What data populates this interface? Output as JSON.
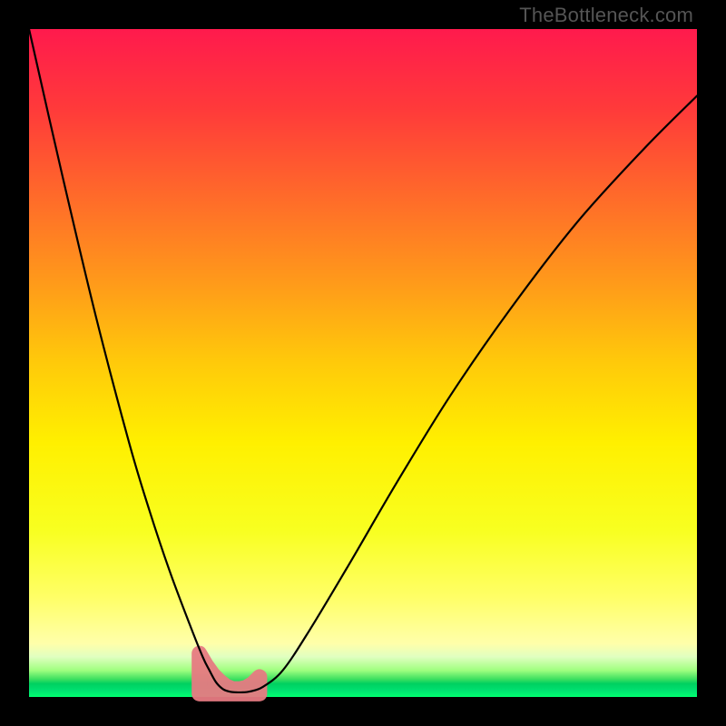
{
  "watermark": "TheBottleneck.com",
  "chart_data": {
    "type": "line",
    "title": "",
    "xlabel": "",
    "ylabel": "",
    "xlim": [
      0,
      100
    ],
    "ylim": [
      0,
      100
    ],
    "grid": false,
    "series": [
      {
        "name": "bottleneck-curve",
        "x": [
          0,
          5,
          10,
          15,
          18,
          21,
          24,
          26,
          27,
          28,
          29,
          30,
          31,
          32,
          33,
          35,
          38,
          42,
          48,
          55,
          63,
          72,
          82,
          92,
          100
        ],
        "y": [
          100,
          78,
          57,
          38,
          28,
          19,
          11,
          6,
          4,
          2.2,
          1.2,
          0.8,
          0.7,
          0.7,
          0.8,
          1.5,
          4,
          10,
          20,
          32,
          45,
          58,
          71,
          82,
          90
        ],
        "color": "#000000"
      }
    ],
    "highlight_band": {
      "name": "optimal-zone",
      "x": [
        25.5,
        26.5,
        27.5,
        28.5,
        29.5,
        30.5,
        31.5,
        32.5,
        33.5,
        34.5
      ],
      "y_top": [
        6.5,
        4.8,
        3.4,
        2.4,
        1.6,
        1.2,
        1.2,
        1.4,
        2.0,
        3.0
      ],
      "y_bot": [
        0.5,
        0.5,
        0.5,
        0.5,
        0.5,
        0.5,
        0.5,
        0.5,
        0.5,
        0.5
      ],
      "color": "#e77b82"
    },
    "background_gradient": {
      "top": "#ff1a4d",
      "mid": "#fff000",
      "bottom": "#00ff70"
    }
  }
}
